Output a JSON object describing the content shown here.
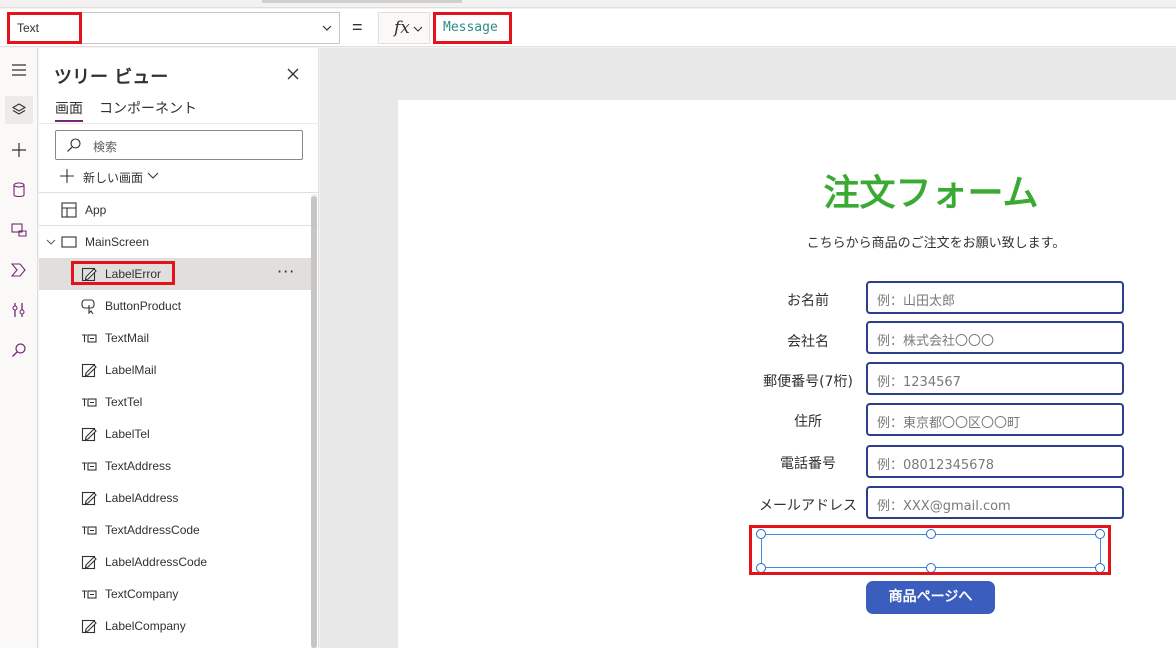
{
  "formula_bar": {
    "property": "Text",
    "equals": "=",
    "fx_label": "fx",
    "formula": "Message"
  },
  "rail": {
    "icons": [
      "hamburger-icon",
      "layers-icon",
      "plus-icon",
      "database-icon",
      "media-icon",
      "power-automate-icon",
      "tools-icon",
      "search-icon"
    ]
  },
  "tree": {
    "title": "ツリー ビュー",
    "tabs": [
      {
        "label": "画面",
        "active": true
      },
      {
        "label": "コンポーネント",
        "active": false
      }
    ],
    "search_placeholder": "検索",
    "new_screen_label": "新しい画面",
    "app_label": "App",
    "screen_label": "MainScreen",
    "controls": [
      {
        "name": "LabelError",
        "type": "label",
        "selected": true
      },
      {
        "name": "ButtonProduct",
        "type": "button",
        "selected": false
      },
      {
        "name": "TextMail",
        "type": "text-input",
        "selected": false
      },
      {
        "name": "LabelMail",
        "type": "label",
        "selected": false
      },
      {
        "name": "TextTel",
        "type": "text-input",
        "selected": false
      },
      {
        "name": "LabelTel",
        "type": "label",
        "selected": false
      },
      {
        "name": "TextAddress",
        "type": "text-input",
        "selected": false
      },
      {
        "name": "LabelAddress",
        "type": "label",
        "selected": false
      },
      {
        "name": "TextAddressCode",
        "type": "text-input",
        "selected": false
      },
      {
        "name": "LabelAddressCode",
        "type": "label",
        "selected": false
      },
      {
        "name": "TextCompany",
        "type": "text-input",
        "selected": false
      },
      {
        "name": "LabelCompany",
        "type": "label",
        "selected": false
      }
    ],
    "more_label": "···"
  },
  "form": {
    "title": "注文フォーム",
    "subtitle": "こちらから商品のご注文をお願い致します。",
    "fields": [
      {
        "label": "お名前",
        "placeholder": "例：山田太郎"
      },
      {
        "label": "会社名",
        "placeholder": "例：株式会社〇〇〇"
      },
      {
        "label": "郵便番号(7桁)",
        "placeholder": "例：1234567"
      },
      {
        "label": "住所",
        "placeholder": "例：東京都〇〇区〇〇町"
      },
      {
        "label": "電話番号",
        "placeholder": "例：08012345678"
      },
      {
        "label": "メールアドレス",
        "placeholder": "例：XXX@gmail.com"
      }
    ],
    "button_label": "商品ページへ"
  },
  "colors": {
    "title_green": "#3aaa35",
    "button_blue": "#3b5dbd",
    "input_border": "#2b3e8c",
    "highlight_red": "#e3121b",
    "formula_teal": "#2e8b8b"
  }
}
